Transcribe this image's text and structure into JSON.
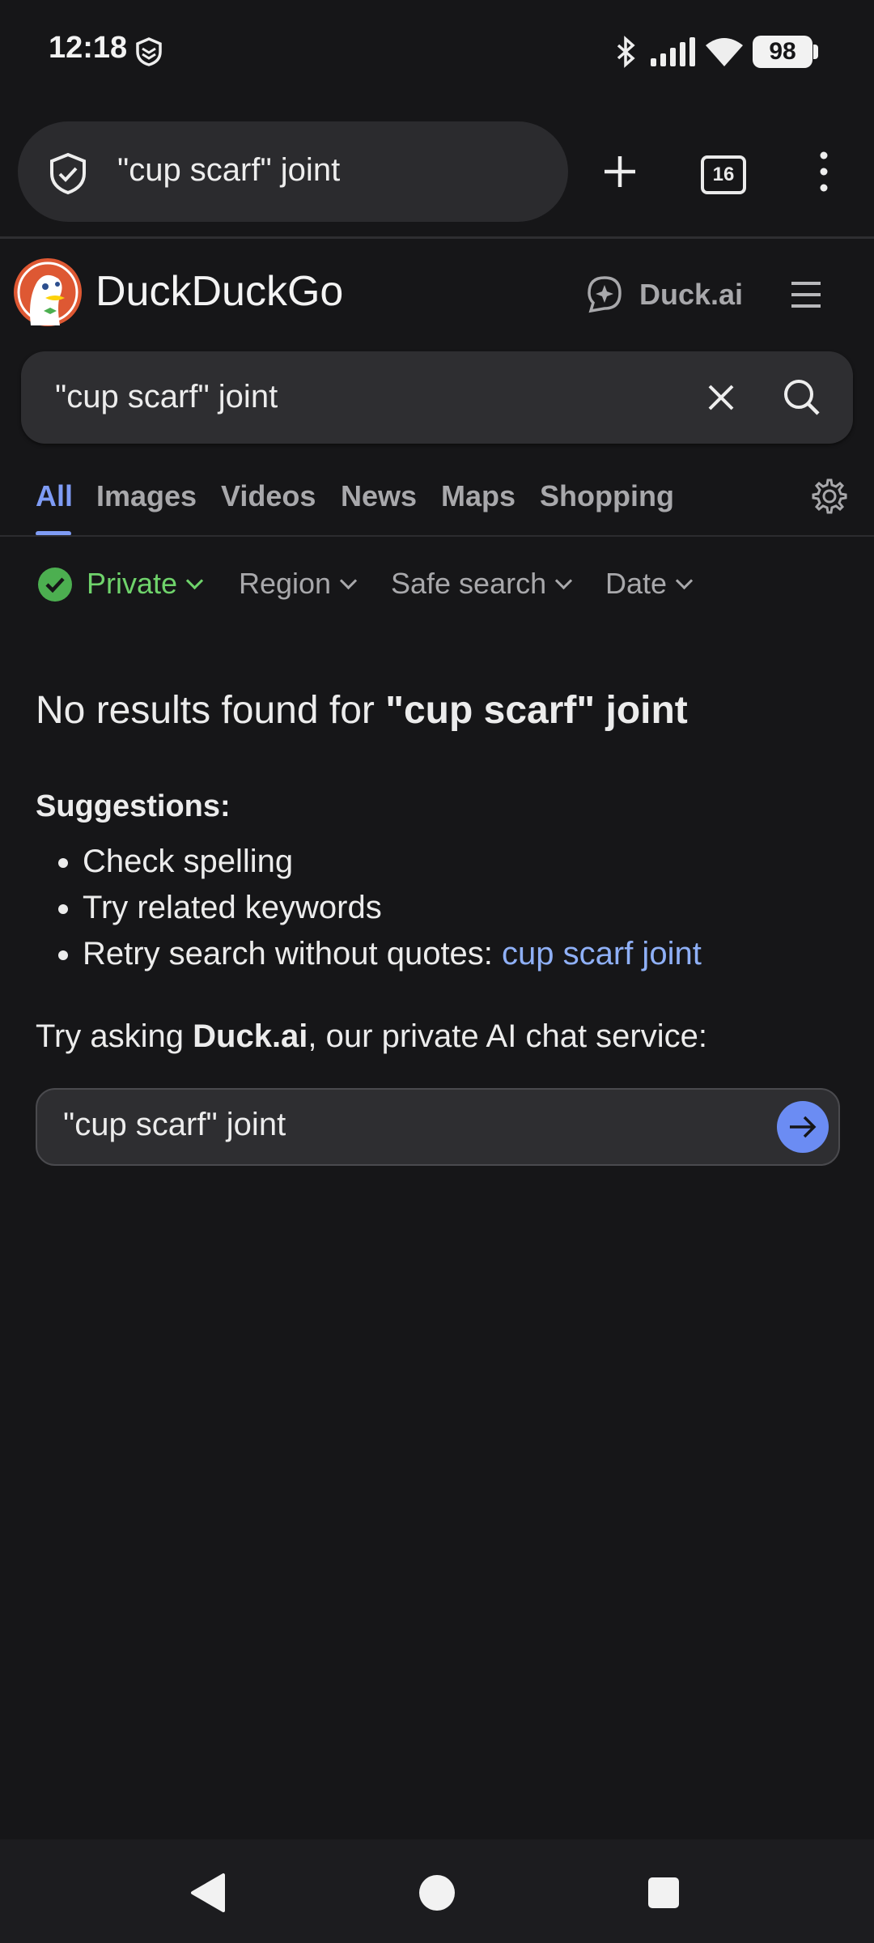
{
  "status_bar": {
    "time": "12:18",
    "battery": "98"
  },
  "browser": {
    "url_text": "\"cup scarf\" joint",
    "tab_count": "16"
  },
  "ddg": {
    "title": "DuckDuckGo",
    "duckai_label": "Duck.ai"
  },
  "search": {
    "query": "\"cup scarf\" joint"
  },
  "tabs": [
    {
      "label": "All"
    },
    {
      "label": "Images"
    },
    {
      "label": "Videos"
    },
    {
      "label": "News"
    },
    {
      "label": "Maps"
    },
    {
      "label": "Shopping"
    }
  ],
  "filters": {
    "private": "Private",
    "region": "Region",
    "safe_search": "Safe search",
    "date": "Date"
  },
  "results": {
    "no_results_prefix": "No results found for ",
    "no_results_query": "\"cup scarf\" joint",
    "suggestions_title": "Suggestions:",
    "suggestion_1": "Check spelling",
    "suggestion_2": "Try related keywords",
    "suggestion_3_prefix": "Retry search without quotes: ",
    "suggestion_3_link": "cup scarf joint"
  },
  "duckai_prompt": {
    "prefix": "Try asking ",
    "brand": "Duck.ai",
    "suffix": ", our private AI chat service:",
    "input_value": "\"cup scarf\" joint"
  },
  "colors": {
    "accent": "#7f9cf5",
    "private_green": "#6fd36b",
    "link": "#8fb0f7",
    "send_button": "#6b8cf3"
  }
}
